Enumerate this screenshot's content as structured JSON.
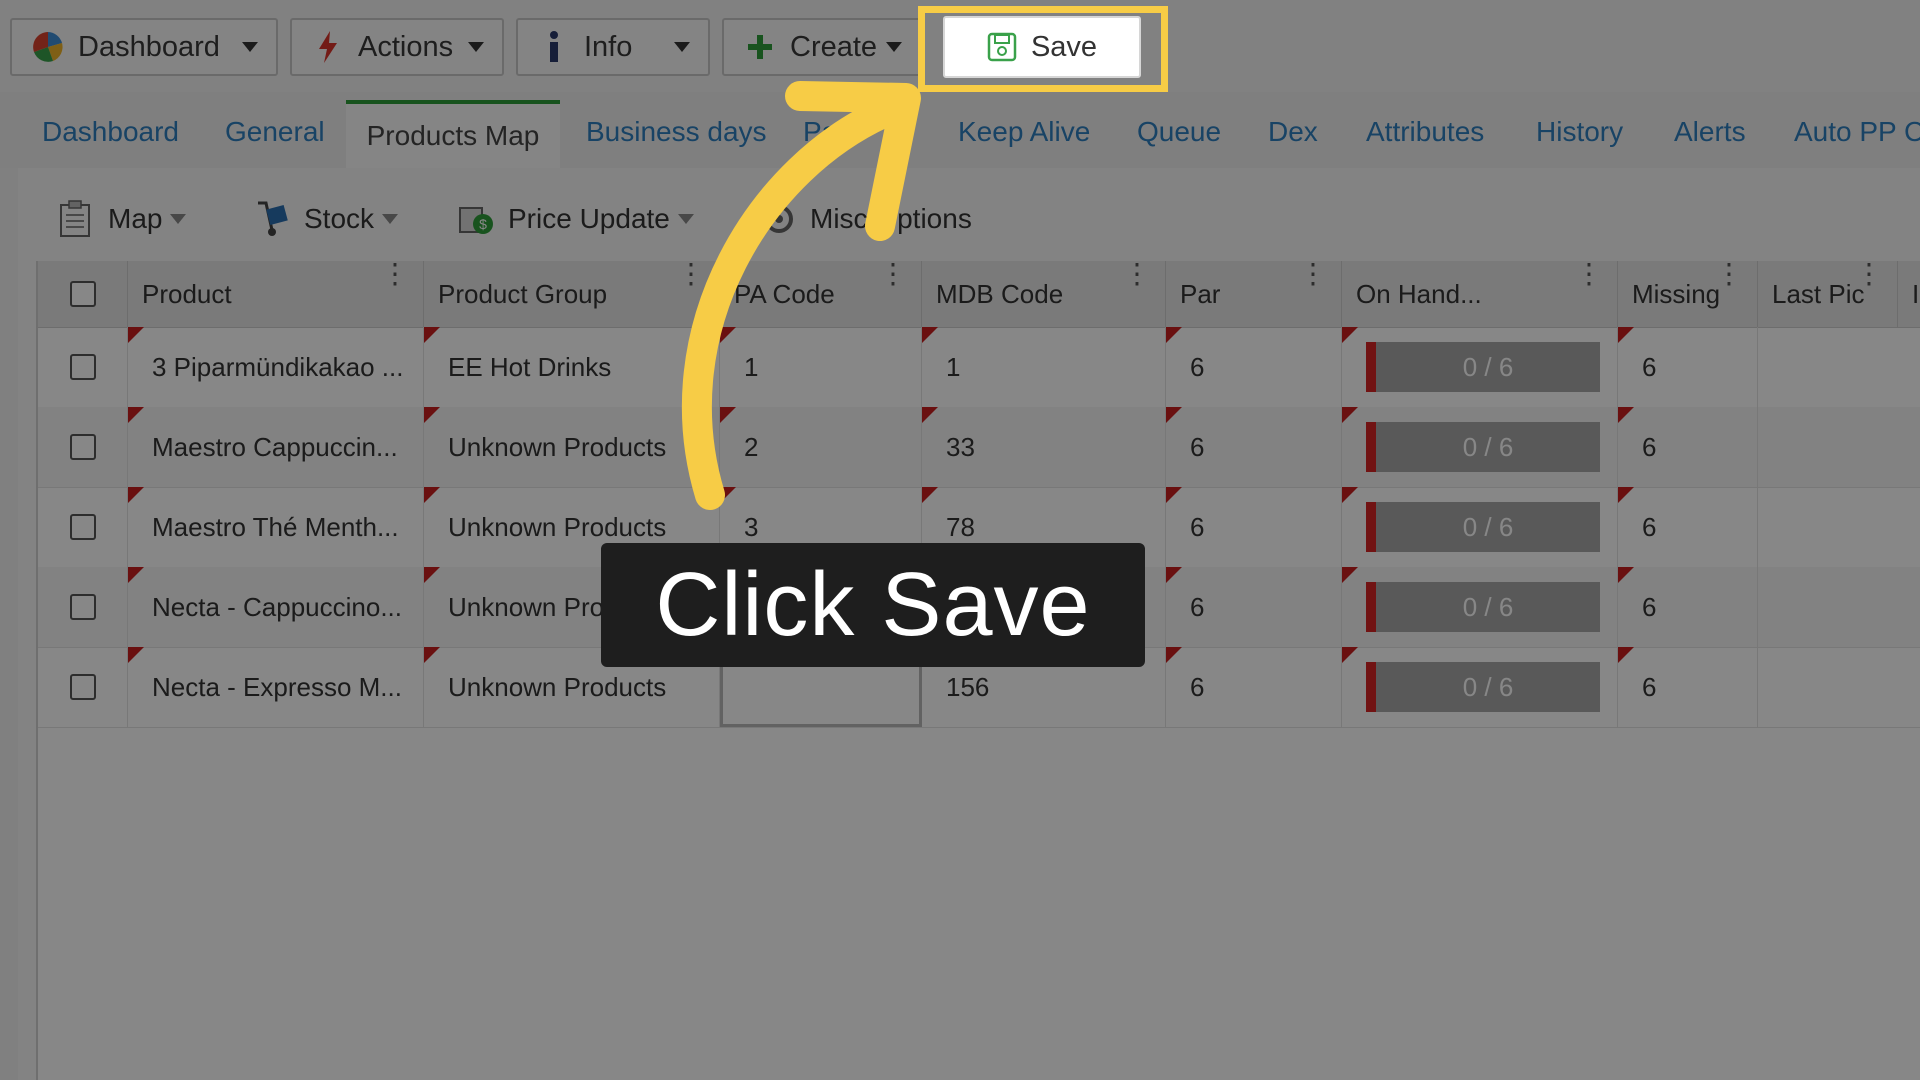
{
  "toolbar": {
    "buttons": [
      {
        "label": "Dashboard",
        "icon": "pie-chart-icon"
      },
      {
        "label": "Actions",
        "icon": "lightning-icon"
      },
      {
        "label": "Info",
        "icon": "info-icon"
      },
      {
        "label": "Create",
        "icon": "plus-icon"
      }
    ],
    "save_label": "Save"
  },
  "tabs": [
    "Dashboard",
    "General",
    "Products Map",
    "Business days",
    "Pay",
    "Keep Alive",
    "Queue",
    "Dex",
    "Attributes",
    "History",
    "Alerts",
    "Auto PP C"
  ],
  "active_tab": "Products Map",
  "subtoolbar": [
    "Map",
    "Stock",
    "Price Update",
    "Misc Options"
  ],
  "grid": {
    "columns": [
      "",
      "Product",
      "Product Group",
      "PA Code",
      "MDB Code",
      "Par",
      "On Hand...",
      "Missing",
      "Last Pic",
      "I"
    ],
    "rows": [
      {
        "product": "3 Piparmündikakao ...",
        "group": "EE Hot Drinks",
        "pa": "1",
        "mdb": "1",
        "par": "6",
        "onhand": "0 / 6",
        "missing": "6"
      },
      {
        "product": "Maestro Cappuccin...",
        "group": "Unknown Products",
        "pa": "2",
        "mdb": "33",
        "par": "6",
        "onhand": "0 / 6",
        "missing": "6"
      },
      {
        "product": "Maestro Thé Menth...",
        "group": "Unknown Products",
        "pa": "3",
        "mdb": "78",
        "par": "6",
        "onhand": "0 / 6",
        "missing": "6"
      },
      {
        "product": "Necta - Cappuccino...",
        "group": "Unknown Products",
        "pa": "",
        "mdb": "",
        "par": "6",
        "onhand": "0 / 6",
        "missing": "6"
      },
      {
        "product": "Necta - Expresso M...",
        "group": "Unknown Products",
        "pa": "",
        "mdb": "156",
        "par": "6",
        "onhand": "0 / 6",
        "missing": "6"
      }
    ]
  },
  "callout": {
    "text": "Click Save"
  },
  "colors": {
    "highlight": "#f7cc46",
    "tab_link": "#2f7fbf",
    "active_tab_border": "#2e9d3a",
    "flag": "#c81f1f"
  }
}
